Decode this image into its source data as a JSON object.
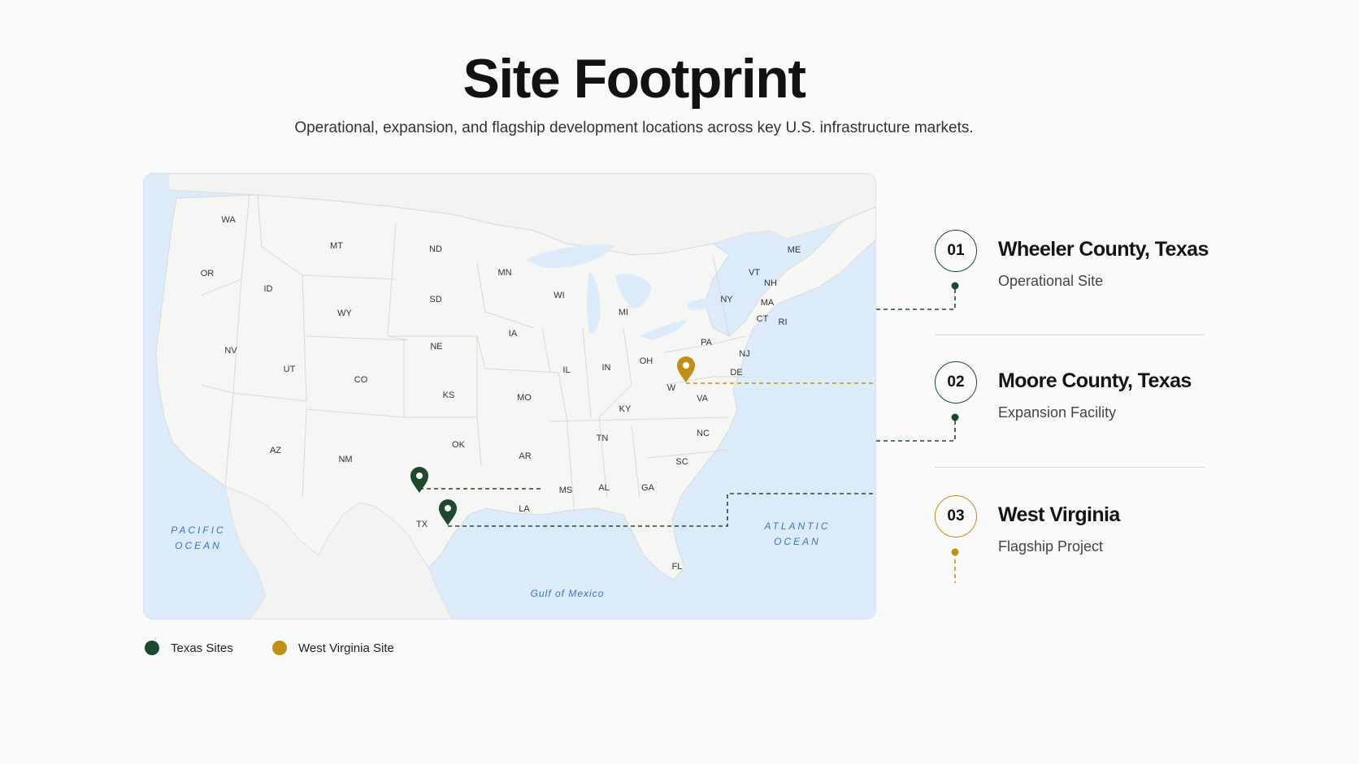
{
  "header": {
    "title": "Site Footprint",
    "subtitle": "Operational, expansion, and flagship development locations across key U.S. infrastructure markets."
  },
  "colors": {
    "texas": "#1d4a2c",
    "west_virginia": "#c08f13",
    "water": "#dcebfa",
    "land": "#f6f6f4"
  },
  "map": {
    "state_labels": [
      "WA",
      "OR",
      "MT",
      "ID",
      "ND",
      "MN",
      "SD",
      "WY",
      "NV",
      "UT",
      "CO",
      "NE",
      "KS",
      "IA",
      "WI",
      "MI",
      "IL",
      "IN",
      "OH",
      "MO",
      "OK",
      "AZ",
      "NM",
      "TX",
      "AR",
      "KY",
      "TN",
      "MS",
      "AL",
      "GA",
      "LA",
      "SC",
      "NC",
      "VA",
      "W",
      "PA",
      "NY",
      "VT",
      "NH",
      "ME",
      "MA",
      "CT",
      "RI",
      "NJ",
      "DE",
      "FL"
    ],
    "ocean_labels": {
      "pacific_line1": "PACIFIC",
      "pacific_line2": "OCEAN",
      "atlantic_line1": "ATLANTIC",
      "atlantic_line2": "OCEAN",
      "gulf": "Gulf of Mexico"
    },
    "markers": [
      {
        "name": "Wheeler County, Texas",
        "icon": "map-pin-icon",
        "group": "texas"
      },
      {
        "name": "Moore County, Texas",
        "icon": "map-pin-icon",
        "group": "texas"
      },
      {
        "name": "West Virginia",
        "icon": "map-pin-icon",
        "group": "west_virginia"
      }
    ]
  },
  "sites": [
    {
      "number": "01",
      "name": "Wheeler County, Texas",
      "type": "Operational Site",
      "group": "texas"
    },
    {
      "number": "02",
      "name": "Moore County, Texas",
      "type": "Expansion Facility",
      "group": "texas"
    },
    {
      "number": "03",
      "name": "West Virginia",
      "type": "Flagship Project",
      "group": "west_virginia"
    }
  ],
  "legend": {
    "texas_label": "Texas Sites",
    "west_virginia_label": "West Virginia Site"
  }
}
